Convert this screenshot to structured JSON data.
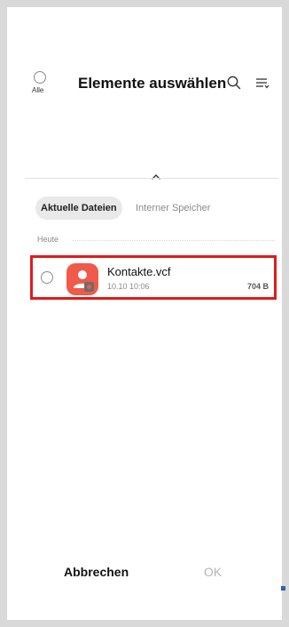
{
  "header": {
    "select_all_label": "Alle",
    "title": "Elemente auswählen",
    "icons": [
      "search-icon",
      "sort-icon"
    ]
  },
  "tabs": [
    {
      "label": "Aktuelle Dateien",
      "active": true
    },
    {
      "label": "Interner Speicher",
      "active": false
    }
  ],
  "section": {
    "label": "Heute"
  },
  "files": [
    {
      "name": "Kontakte.vcf",
      "date": "10.10 10:06",
      "size": "704 B",
      "icon": "contacts-file-icon"
    }
  ],
  "actions": {
    "cancel_label": "Abbrechen",
    "ok_label": "OK"
  },
  "colors": {
    "highlight_border": "#e01b1b",
    "file_icon": "#ef5a4a",
    "tab_active_bg": "#e9e9e9",
    "ok_disabled": "#b5b5b5"
  }
}
